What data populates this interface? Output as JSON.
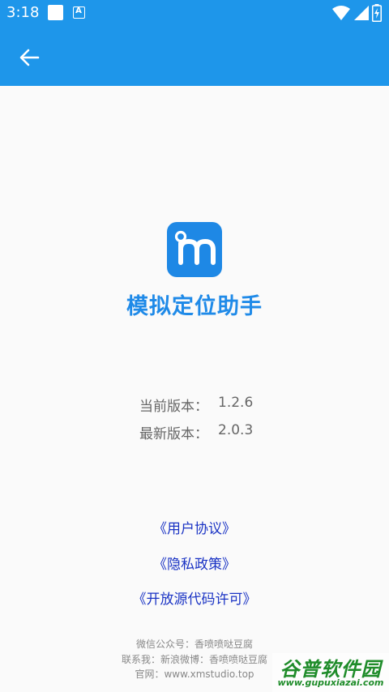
{
  "status_bar": {
    "time": "3:18",
    "icons": [
      "notification-square-icon",
      "a-badge-icon",
      "wifi-icon",
      "signal-icon",
      "battery-icon"
    ],
    "a_badge_letter": "A"
  },
  "toolbar": {
    "back_icon": "arrow-left-icon",
    "color": "#1e96ea"
  },
  "app": {
    "name": "模拟定位助手",
    "logo_letter": "m"
  },
  "versions": {
    "current_label": "当前版本：",
    "current_value": "1.2.6",
    "latest_label": "最新版本：",
    "latest_value": "2.0.3"
  },
  "links": {
    "user_agreement": "《用户协议》",
    "privacy_policy": "《隐私政策》",
    "open_source": "《开放源代码许可》"
  },
  "footer": {
    "wechat": "微信公众号：香喷喷哒豆腐",
    "weibo": "联系我：新浪微博：香喷喷哒豆腐",
    "website": "官网：www.xmstudio.top"
  },
  "watermark": {
    "text": "谷普软件园",
    "url": "www.gupuxiazai.com"
  },
  "colors": {
    "accent": "#1e96ea",
    "link": "#1a33c4",
    "app_name": "#1f8ae8"
  }
}
